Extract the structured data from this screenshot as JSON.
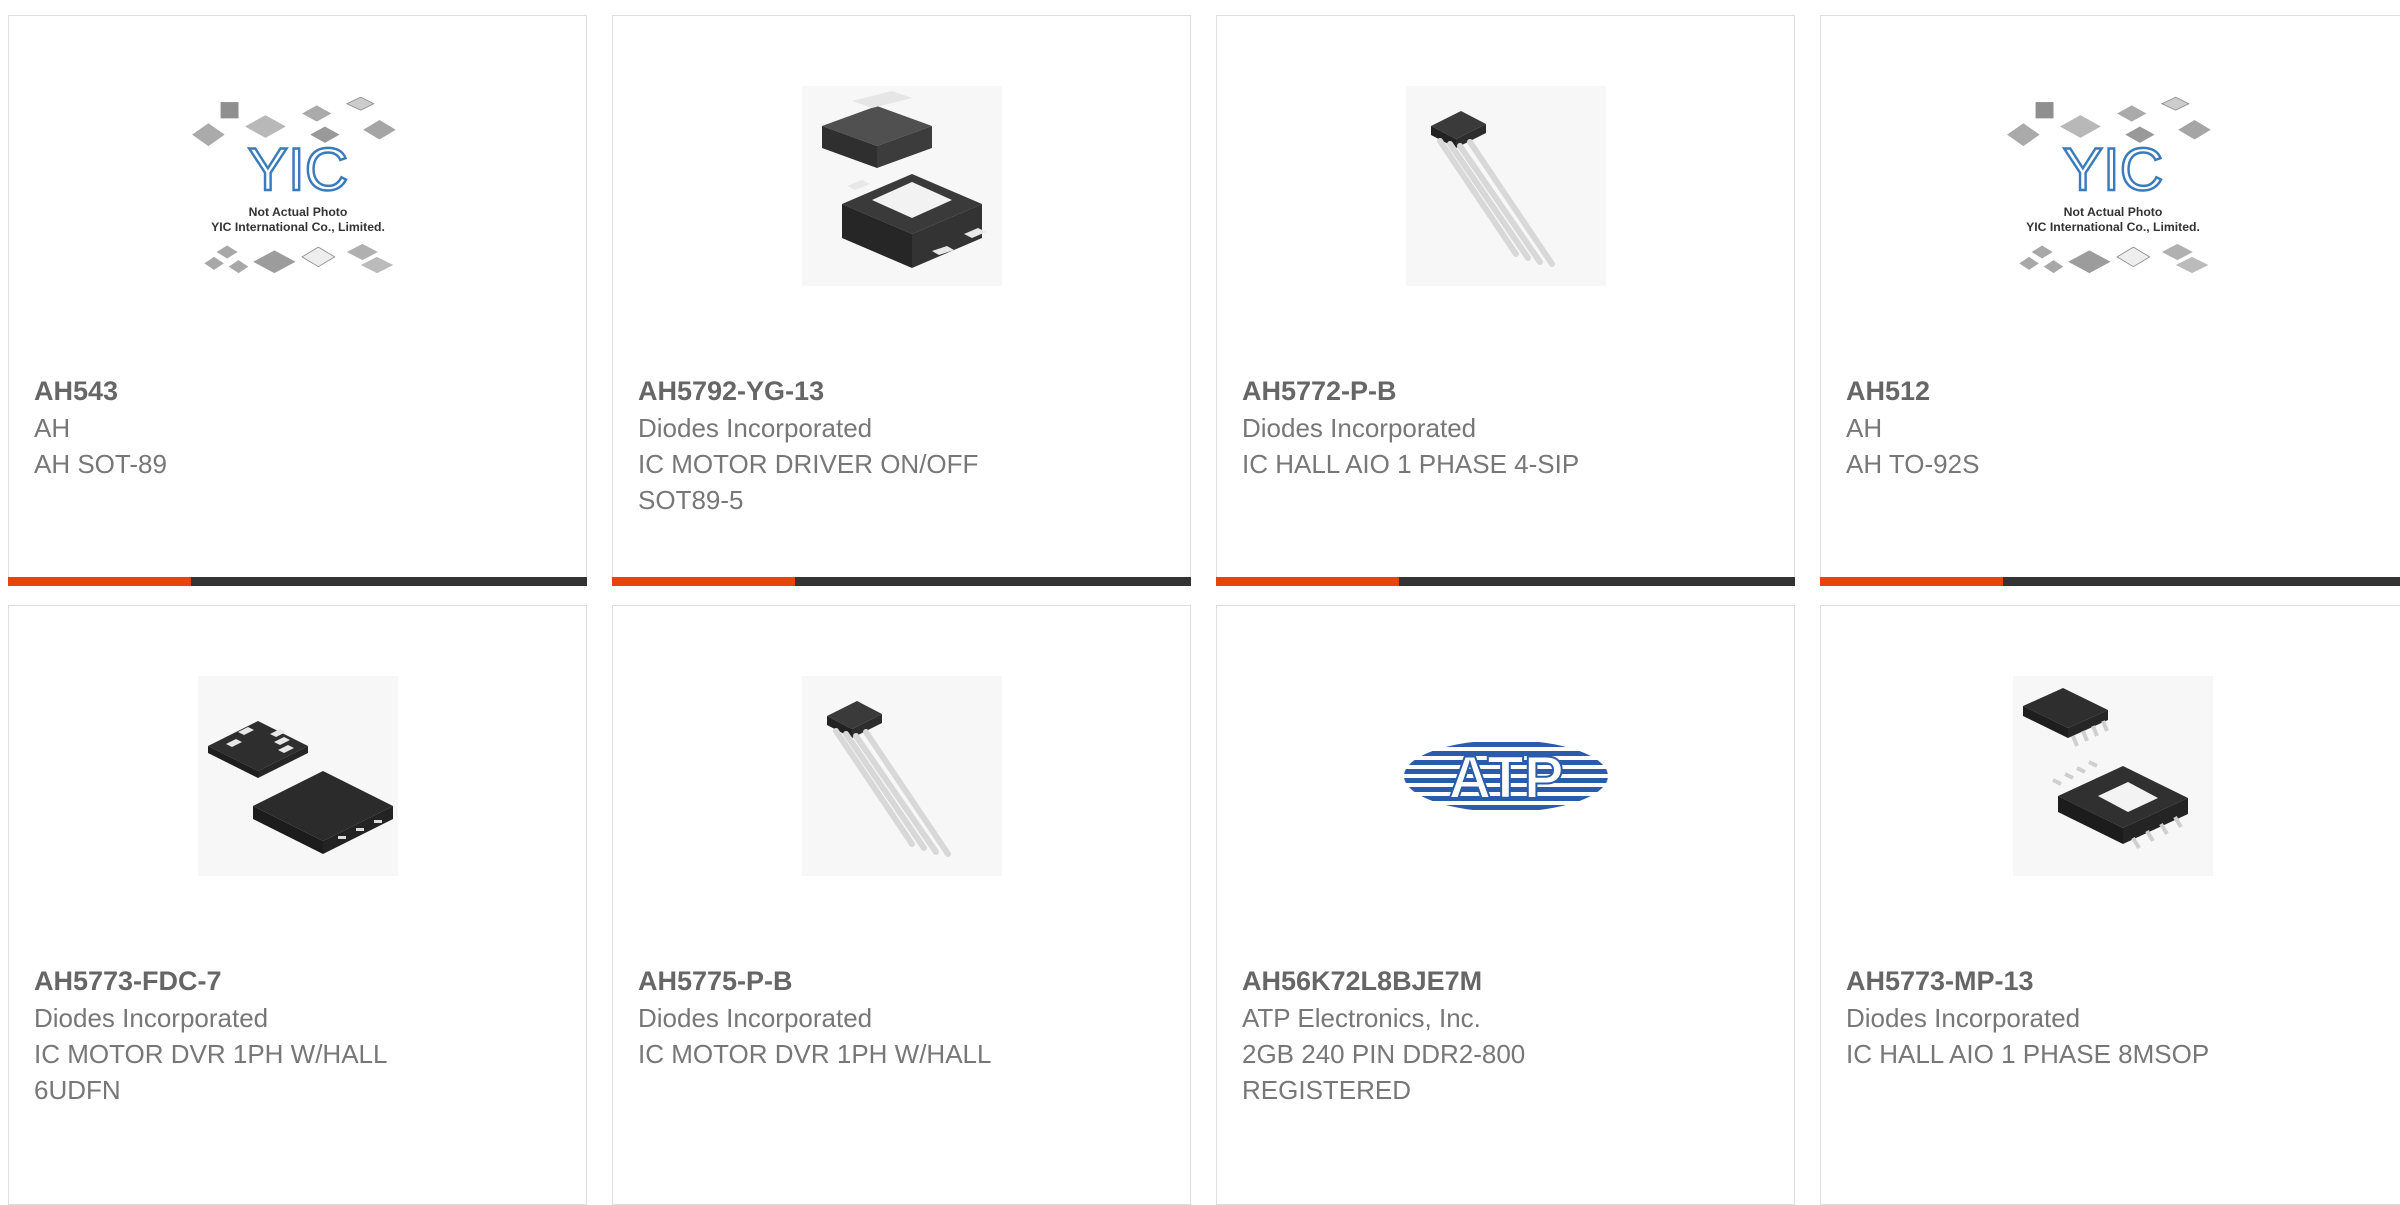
{
  "products": [
    {
      "part": "AH543",
      "manufacturer": "AH",
      "description": "AH SOT-89",
      "image": "yic-not-actual-photo",
      "photo_caption": "Not Actual Photo",
      "photo_company": "YIC International Co., Limited.",
      "brand": "YIC"
    },
    {
      "part": "AH5792-YG-13",
      "manufacturer": "Diodes Incorporated",
      "description": "IC MOTOR DRIVER ON/OFF SOT89-5",
      "image": "sot89-package"
    },
    {
      "part": "AH5772-P-B",
      "manufacturer": "Diodes Incorporated",
      "description": "IC HALL AIO 1 PHASE 4-SIP",
      "image": "sip4-package"
    },
    {
      "part": "AH512",
      "manufacturer": "AH",
      "description": "AH TO-92S",
      "image": "yic-not-actual-photo",
      "photo_caption": "Not Actual Photo",
      "photo_company": "YIC International Co., Limited.",
      "brand": "YIC"
    },
    {
      "part": "AH5773-FDC-7",
      "manufacturer": "Diodes Incorporated",
      "description": "IC MOTOR DVR 1PH W/HALL 6UDFN",
      "image": "udfn-package"
    },
    {
      "part": "AH5775-P-B",
      "manufacturer": "Diodes Incorporated",
      "description": "IC MOTOR DVR 1PH W/HALL",
      "image": "sip4-package"
    },
    {
      "part": "AH56K72L8BJE7M",
      "manufacturer": "ATP Electronics, Inc.",
      "description": "2GB 240 PIN DDR2-800 REGISTERED",
      "image": "atp-logo",
      "brand": "ATP"
    },
    {
      "part": "AH5773-MP-13",
      "manufacturer": "Diodes Incorporated",
      "description": "IC HALL AIO 1 PHASE 8MSOP",
      "image": "msop-package"
    }
  ],
  "colors": {
    "accent": "#e8420f",
    "bar": "#333333",
    "border": "#dedede",
    "text": "#666666"
  }
}
